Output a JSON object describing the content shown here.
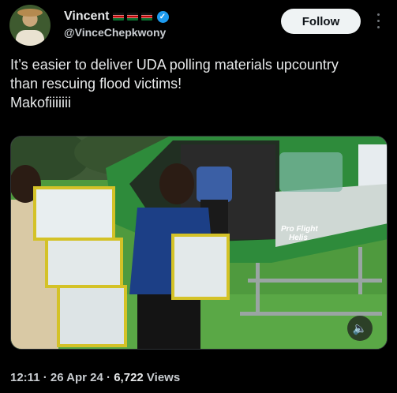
{
  "author": {
    "name": "Vincent",
    "handle": "@VinceChepkwony",
    "verified_mark": "✓"
  },
  "follow_button": {
    "label": "Follow"
  },
  "tweet": {
    "text": "It’s easier to deliver UDA polling materials upcountry\nthan rescuing flood victims!\nMakofiiiiiii"
  },
  "media": {
    "helicopter_text": "Pro Flight\nHelis",
    "mute_icon": "🔈"
  },
  "meta": {
    "time": "12:11",
    "separator": " · ",
    "date": "26 Apr 24",
    "views_count": "6,722",
    "views_label": " Views"
  }
}
